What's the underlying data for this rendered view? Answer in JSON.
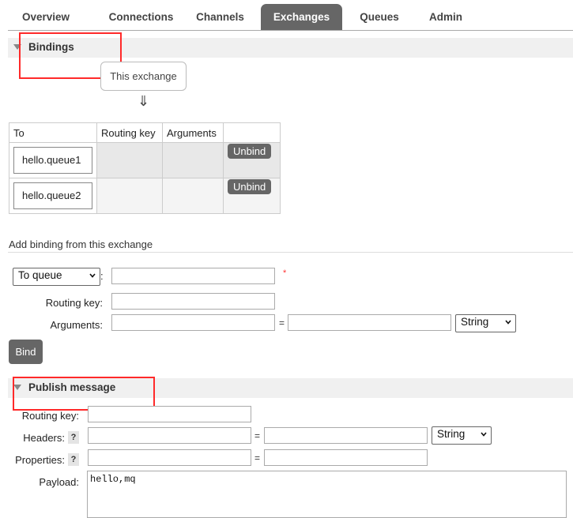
{
  "nav": {
    "tabs": [
      {
        "label": "Overview"
      },
      {
        "label": "Connections"
      },
      {
        "label": "Channels"
      },
      {
        "label": "Exchanges",
        "active": true
      },
      {
        "label": "Queues"
      },
      {
        "label": "Admin"
      }
    ]
  },
  "bindings": {
    "title": "Bindings",
    "exchange_label": "This exchange",
    "arrow": "⇓",
    "columns": [
      "To",
      "Routing key",
      "Arguments",
      ""
    ],
    "rows": [
      {
        "to": "hello.queue1",
        "routing_key": "",
        "arguments": "",
        "action": "Unbind"
      },
      {
        "to": "hello.queue2",
        "routing_key": "",
        "arguments": "",
        "action": "Unbind"
      }
    ]
  },
  "add_binding": {
    "title": "Add binding from this exchange",
    "destination_type": "To queue",
    "colon": ":",
    "required_mark": "*",
    "routing_key_label": "Routing key:",
    "arguments_label": "Arguments:",
    "equals": "=",
    "arg_type": "String",
    "bind_button": "Bind"
  },
  "publish": {
    "title": "Publish message",
    "routing_key_label": "Routing key:",
    "headers_label": "Headers:",
    "properties_label": "Properties:",
    "help_mark": "?",
    "equals": "=",
    "header_type": "String",
    "payload_label": "Payload:",
    "payload_value": "hello,mq"
  },
  "colors": {
    "active_tab": "#666666",
    "button": "#666666",
    "annotation_box": "#ff2a2a",
    "required": "#ff3333"
  }
}
